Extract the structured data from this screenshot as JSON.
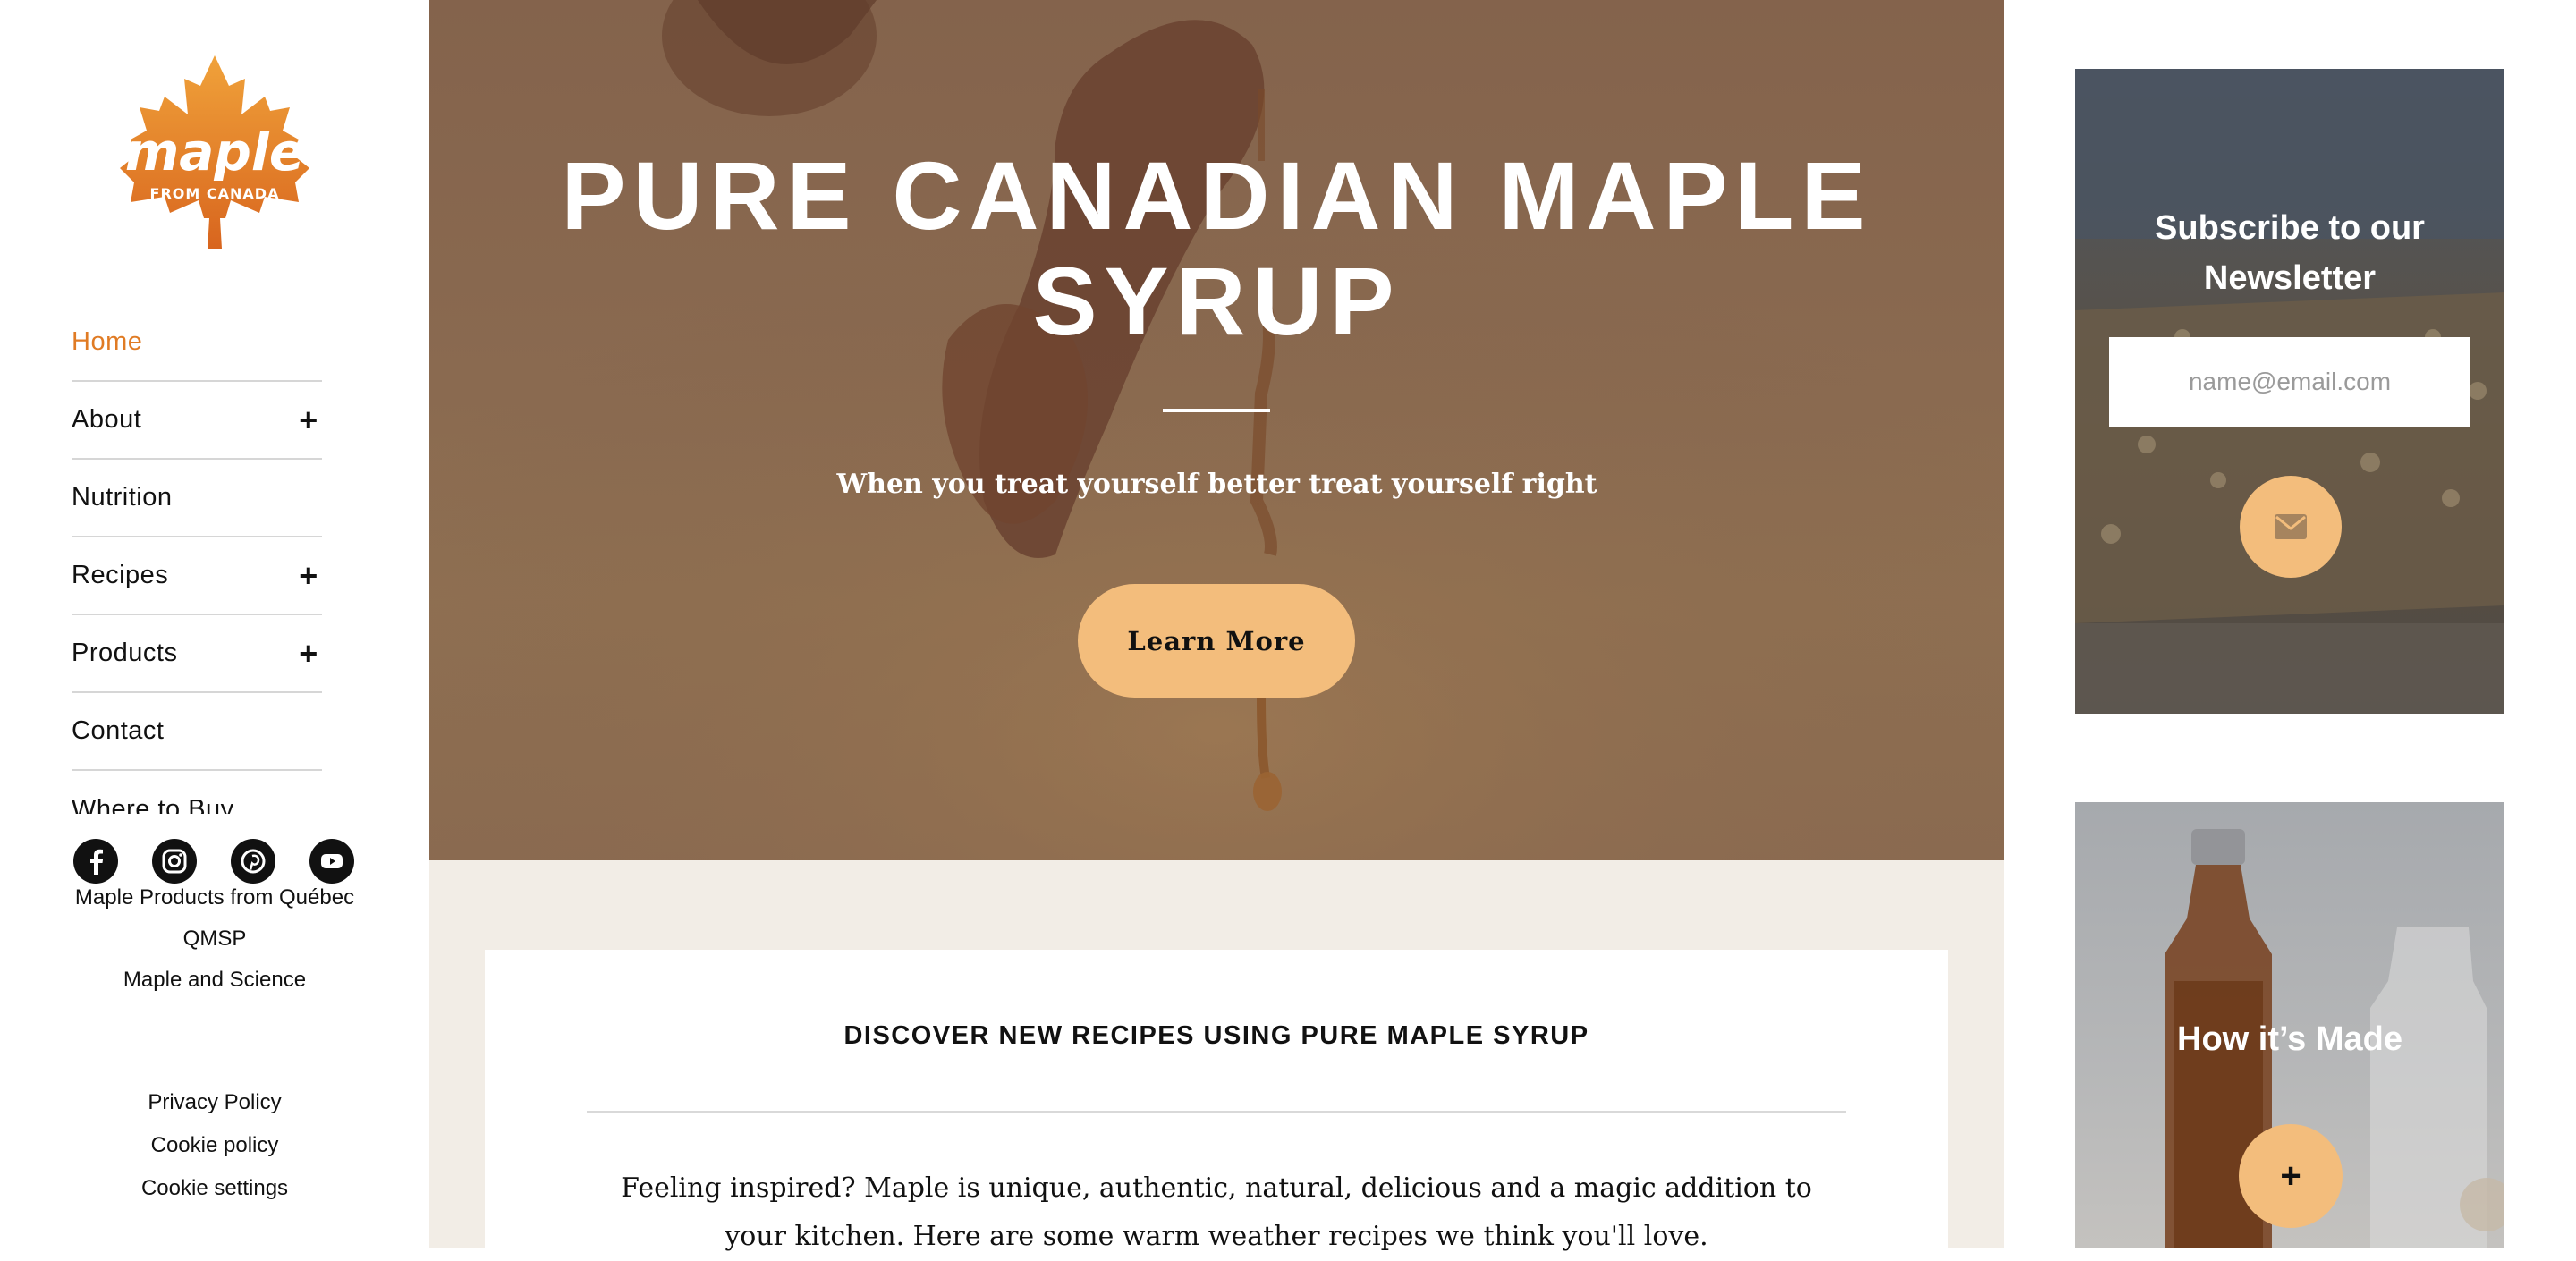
{
  "brand": {
    "logo_word": "maple",
    "logo_sub": "FROM CANADA",
    "accent_color": "#e07b24",
    "button_color": "#f3bd7c"
  },
  "sidebar": {
    "nav": [
      {
        "label": "Home",
        "active": true,
        "expandable": false
      },
      {
        "label": "About",
        "active": false,
        "expandable": true
      },
      {
        "label": "Nutrition",
        "active": false,
        "expandable": false
      },
      {
        "label": "Recipes",
        "active": false,
        "expandable": true
      },
      {
        "label": "Products",
        "active": false,
        "expandable": true
      },
      {
        "label": "Contact",
        "active": false,
        "expandable": false
      },
      {
        "label": "Where to Buy",
        "active": false,
        "expandable": false
      }
    ],
    "expand_symbol": "+",
    "social": [
      "facebook-icon",
      "instagram-icon",
      "pinterest-icon",
      "youtube-icon"
    ],
    "partner_links": [
      "Maple Products from Québec",
      "QMSP",
      "Maple and Science"
    ],
    "legal_links": [
      "Privacy Policy",
      "Cookie policy",
      "Cookie settings"
    ]
  },
  "hero": {
    "title": "PURE CANADIAN MAPLE SYRUP",
    "subtitle": "When you treat yourself better treat yourself right",
    "cta_label": "Learn More"
  },
  "recipes": {
    "heading": "DISCOVER NEW RECIPES USING PURE MAPLE SYRUP",
    "body": "Feeling inspired? Maple is unique, authentic, natural, delicious and a magic addition to your kitchen. Here are some warm weather recipes we think you'll love."
  },
  "newsletter": {
    "title": "Subscribe to our Newsletter",
    "placeholder": "name@email.com",
    "submit_icon": "envelope-icon"
  },
  "how_made": {
    "title": "How it’s Made",
    "button_symbol": "+"
  }
}
